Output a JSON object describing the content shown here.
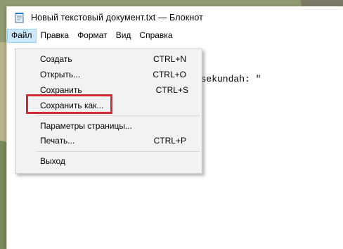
{
  "window": {
    "title": "Новый текстовый документ.txt — Блокнот",
    "icon": "notepad-icon"
  },
  "menubar": {
    "items": [
      {
        "label": "Файл"
      },
      {
        "label": "Правка"
      },
      {
        "label": "Формат"
      },
      {
        "label": "Вид"
      },
      {
        "label": "Справка"
      }
    ]
  },
  "editor": {
    "visible_text": "v sekundah: \""
  },
  "file_menu": {
    "items": [
      {
        "label": "Создать",
        "shortcut": "CTRL+N"
      },
      {
        "label": "Открыть...",
        "shortcut": "CTRL+O"
      },
      {
        "label": "Сохранить",
        "shortcut": "CTRL+S"
      },
      {
        "label": "Сохранить как...",
        "shortcut": ""
      },
      {
        "label": "Параметры страницы...",
        "shortcut": ""
      },
      {
        "label": "Печать...",
        "shortcut": "CTRL+P"
      },
      {
        "label": "Выход",
        "shortcut": ""
      }
    ]
  },
  "colors": {
    "highlight_border": "#d62b35",
    "menu_active_bg": "#cce8ff",
    "menu_bg": "#f2f2f2"
  }
}
